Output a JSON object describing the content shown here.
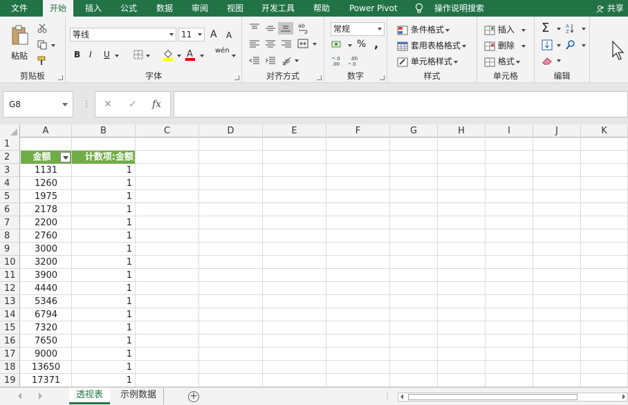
{
  "ribbon_tabs": [
    {
      "label": "文件",
      "active": false
    },
    {
      "label": "开始",
      "active": true
    },
    {
      "label": "插入",
      "active": false
    },
    {
      "label": "公式",
      "active": false
    },
    {
      "label": "数据",
      "active": false
    },
    {
      "label": "审阅",
      "active": false
    },
    {
      "label": "视图",
      "active": false
    },
    {
      "label": "开发工具",
      "active": false
    },
    {
      "label": "帮助",
      "active": false
    },
    {
      "label": "Power Pivot",
      "active": false
    }
  ],
  "tell_me": "操作说明搜索",
  "share": "共享",
  "groups": {
    "clipboard": {
      "label": "剪贴板",
      "paste": "粘贴"
    },
    "font": {
      "label": "字体",
      "font_name": "等线",
      "font_size": "11",
      "bold": "B",
      "italic": "I",
      "underline": "U",
      "grow": "A",
      "shrink": "A",
      "phonetic": "wén"
    },
    "alignment": {
      "label": "对齐方式"
    },
    "number": {
      "label": "数字",
      "format": "常规",
      "percent": "%",
      "comma": ","
    },
    "styles": {
      "label": "样式",
      "conditional": "条件格式",
      "table": "套用表格格式",
      "cell_styles": "单元格样式"
    },
    "cells": {
      "label": "单元格",
      "insert": "插入",
      "delete": "删除",
      "format": "格式"
    },
    "editing": {
      "label": "编辑"
    }
  },
  "formula_bar": {
    "name_box": "G8",
    "cancel": "✕",
    "enter": "✓",
    "fx": "fx",
    "content": ""
  },
  "columns": [
    "A",
    "B",
    "C",
    "D",
    "E",
    "F",
    "G",
    "H",
    "I",
    "J",
    "K"
  ],
  "rows": [
    "1",
    "2",
    "3",
    "4",
    "5",
    "6",
    "7",
    "8",
    "9",
    "10",
    "11",
    "12",
    "13",
    "14",
    "15",
    "16",
    "17",
    "18",
    "19"
  ],
  "pivot": {
    "header_a": "金额",
    "header_b": "计数项:金额",
    "values": [
      {
        "amount": "1131",
        "count": "1"
      },
      {
        "amount": "1260",
        "count": "1"
      },
      {
        "amount": "1975",
        "count": "1"
      },
      {
        "amount": "2178",
        "count": "1"
      },
      {
        "amount": "2200",
        "count": "1"
      },
      {
        "amount": "2760",
        "count": "1"
      },
      {
        "amount": "3000",
        "count": "1"
      },
      {
        "amount": "3200",
        "count": "1"
      },
      {
        "amount": "3900",
        "count": "1"
      },
      {
        "amount": "4440",
        "count": "1"
      },
      {
        "amount": "5346",
        "count": "1"
      },
      {
        "amount": "6794",
        "count": "1"
      },
      {
        "amount": "7320",
        "count": "1"
      },
      {
        "amount": "7650",
        "count": "1"
      },
      {
        "amount": "9000",
        "count": "1"
      },
      {
        "amount": "13650",
        "count": "1"
      },
      {
        "amount": "17371",
        "count": "1"
      }
    ]
  },
  "sheets": [
    {
      "label": "透视表",
      "active": true
    },
    {
      "label": "示例数据",
      "active": false
    }
  ],
  "colors": {
    "accent": "#217346",
    "pivot_header": "#70ad47"
  }
}
